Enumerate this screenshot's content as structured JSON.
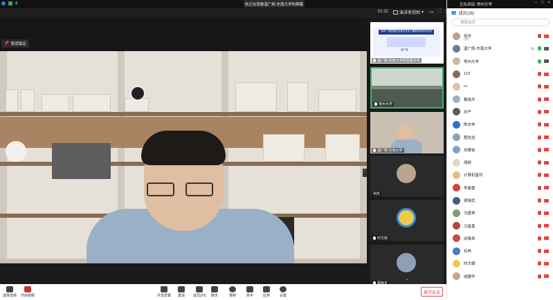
{
  "topbar": {
    "sharing_notice": "你正在观看温广辉-东南大学的屏幕",
    "timer": "01:22",
    "view_label": "演讲者视图"
  },
  "main_video": {
    "stop_pin": "取消锁定"
  },
  "thumbnails": [
    {
      "label": "温广辉-东南大学的屏幕共享",
      "kind": "slide"
    },
    {
      "label": "常州大学",
      "kind": "classroom",
      "active": true
    },
    {
      "label": "温广辉-东南大学",
      "kind": "speaker"
    },
    {
      "label": "何杰",
      "kind": "avatar"
    },
    {
      "label": "时文娟",
      "kind": "cartoon"
    },
    {
      "label": "程映龙",
      "kind": "astronaut"
    }
  ],
  "slide": {
    "title": "协同一致性理论及其在多无人集群系统中的应用",
    "presenter": "温广辉"
  },
  "bottom_bar": {
    "audio": "选择音频",
    "video": "开启视频",
    "share": "共享屏幕",
    "invite": "邀请",
    "members": "成员(26)",
    "chat": "聊天",
    "record": "录制",
    "hand": "举手",
    "apps": "应用",
    "settings": "设置",
    "leave": "离开会议"
  },
  "panel": {
    "talking": "正在讲话: 常州大学",
    "members_title": "成员(26)",
    "search_placeholder": "搜索成员",
    "members": [
      {
        "name": "何杰",
        "sub": "(我)",
        "avatar_color": "#b9a48d",
        "mic": "muted",
        "cam": "off"
      },
      {
        "name": "温广辉-东南大学",
        "sub": "",
        "avatar_color": "#6a7d95",
        "mic": "on",
        "cam": "on"
      },
      {
        "name": "常州大学",
        "sub": "",
        "avatar_color": "#c7b9a4",
        "mic": "on",
        "cam": "on"
      },
      {
        "name": "123",
        "sub": "",
        "avatar_color": "#8c6a5a",
        "mic": "muted",
        "cam": "off"
      },
      {
        "name": "cc",
        "sub": "",
        "avatar_color": "#d9c4a8",
        "mic": "muted",
        "cam": "off"
      },
      {
        "name": "蔡成杰",
        "sub": "",
        "avatar_color": "#a3b2c1",
        "mic": "muted",
        "cam": "off"
      },
      {
        "name": "孙严",
        "sub": "",
        "avatar_color": "#5c5c5c",
        "mic": "muted",
        "cam": "off"
      },
      {
        "name": "陈志祥",
        "sub": "",
        "avatar_color": "#2e6fd1",
        "mic": "muted",
        "cam": "off"
      },
      {
        "name": "程玟龙",
        "sub": "",
        "avatar_color": "#8e9fb8",
        "mic": "muted",
        "cam": "off"
      },
      {
        "name": "刘蓉怡",
        "sub": "",
        "avatar_color": "#7fa3c8",
        "mic": "muted",
        "cam": "off"
      },
      {
        "name": "胡锐",
        "sub": "",
        "avatar_color": "#e3d6c6",
        "mic": "muted",
        "cam": "off"
      },
      {
        "name": "计算机星玲",
        "sub": "",
        "avatar_color": "#e2c07a",
        "mic": "muted",
        "cam": "off"
      },
      {
        "name": "李曼蕾",
        "sub": "",
        "avatar_color": "#d0483b",
        "mic": "muted",
        "cam": "off"
      },
      {
        "name": "梁晓武",
        "sub": "",
        "avatar_color": "#3a5f8a",
        "mic": "muted",
        "cam": "off"
      },
      {
        "name": "马盛林",
        "sub": "",
        "avatar_color": "#8a9a6a",
        "mic": "muted",
        "cam": "off"
      },
      {
        "name": "马星鑫",
        "sub": "",
        "avatar_color": "#b04a3a",
        "mic": "muted",
        "cam": "off"
      },
      {
        "name": "邱泰来",
        "sub": "",
        "avatar_color": "#c74b4b",
        "mic": "muted",
        "cam": "off"
      },
      {
        "name": "石林",
        "sub": "",
        "avatar_color": "#4a7bbf",
        "mic": "muted",
        "cam": "off"
      },
      {
        "name": "时文娟",
        "sub": "",
        "avatar_color": "#f0c84a",
        "mic": "muted",
        "cam": "off"
      },
      {
        "name": "成建华",
        "sub": "",
        "avatar_color": "#c9a68a",
        "mic": "muted",
        "cam": "off"
      }
    ]
  },
  "colors": {
    "accent_green": "#3bb36a",
    "muted_red": "#e04646",
    "panel_bg": "#ffffff"
  }
}
